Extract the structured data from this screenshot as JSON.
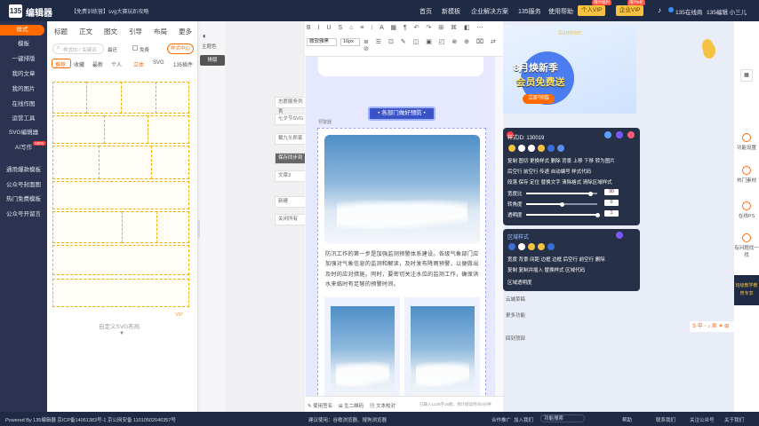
{
  "topbar": {
    "logo_mark": "135",
    "logo_text": "编辑器",
    "notice": "【免费训练营】svg大赛玩趴攻略",
    "nav": [
      "首页",
      "新模板",
      "企业解决方案",
      "135服务",
      "使用帮助"
    ],
    "personal_vip": "个人VIP",
    "enterprise_vip": "企业VIP",
    "promo_badge_1": "限时福利",
    "promo_badge_2": "限时5折",
    "mall": "135在线商",
    "user": "135编辑 小三儿"
  },
  "leftnav": {
    "items": [
      "样式",
      "模板",
      "一键排版",
      "我的文章",
      "我的图片",
      "在线作图",
      "运营工具",
      "SVG编辑器",
      "AI写作",
      "通用爆款模板",
      "公众号封面图",
      "热门免费模板",
      "公众号开留言"
    ],
    "new_badge": "NEW"
  },
  "tplpanel": {
    "categories": [
      "标题",
      "正文",
      "图文",
      "引导",
      "布局",
      "更多"
    ],
    "search_placeholder": "样式ID / 关键词",
    "checks": [
      "最还",
      "免费"
    ],
    "style_center": "样式中心",
    "subtabs": [
      "推荐",
      "收藏",
      "最新",
      "个人",
      "立体",
      "SVG",
      "135插件"
    ],
    "footer_label": "自定义SVG布局",
    "vip_label": "VIP"
  },
  "sidetools": {
    "items": [
      "主题色",
      "排版"
    ]
  },
  "midcol": {
    "items": [
      "志愿服务列表",
      "七夕节SVG",
      "载九头郎家",
      "保存同步到",
      "文章3",
      "新建",
      "关闭所有"
    ]
  },
  "toolbar": {
    "font_label": "微软雅黑",
    "size_label": "16px"
  },
  "article": {
    "header_badge": "• 各部门做好预防 •",
    "tag": "预警器",
    "paragraph": "防汛工作的第一步是加强监测预警体系建设。各级气象部门应加强对气象信息的监测和解读，及时发布降雨预警，以便做出及时的应对措施。同时，要密切关注水位的监测工作，确保洪水来临时有足够的预警时间。"
  },
  "editfoot": {
    "items": [
      "使用签名",
      "生二维码",
      "文本校对"
    ],
    "status": "已输入1226字16图，预计阅读时间3分钟"
  },
  "banner": {
    "title": "8月焕新季",
    "subtitle": "会员免费送",
    "button": "立即领取",
    "tagline": "Summer"
  },
  "style_panel": {
    "title": "样式ID: 130019",
    "row1": "复制  图切  更换样式  删除  背景  上移  下移  转为图片",
    "row2": "后空行  前空行  传递  自动编号  样式代码",
    "row3": "段落  保存  定位  替换文字  清除格式  清除区域样式",
    "labels": [
      "宽度比",
      "转角度",
      "透明度"
    ],
    "values": [
      "90",
      "0",
      "1"
    ],
    "colors": [
      "#f5c242",
      "#ffffff",
      "#ffffff",
      "#f5c242",
      "#3a6fd8",
      "#5a8ff0"
    ]
  },
  "area_panel": {
    "title": "区域样式",
    "row1": "宽度  背景  间距  边框  边框  后空行  前空行  删除",
    "row2": "复制  复制并插入  替换样式  区域代码",
    "row3": "区域透明度",
    "colors": [
      "#3a6fd8",
      "#ffffff",
      "#f5c242",
      "#f5c242",
      "#3a6fd8"
    ]
  },
  "right_small": [
    "云端草稿",
    "更多功能",
    "回到顶部"
  ],
  "right_rail": [
    "功能设置",
    "热门素材",
    "在线PS",
    "有问题找一找",
    "班级教学教育专享"
  ],
  "bottombar": {
    "left": "Powered By 135编辑器  京ICP备14061383号-1  京公网安备 11010502046357号",
    "mid": "建议使用：谷歌浏览器、搜狗浏览器",
    "links": [
      "合作推广",
      "加入我们",
      "功能搜索",
      "帮助",
      "联系我们",
      "关注公众号",
      "关于我们"
    ]
  }
}
